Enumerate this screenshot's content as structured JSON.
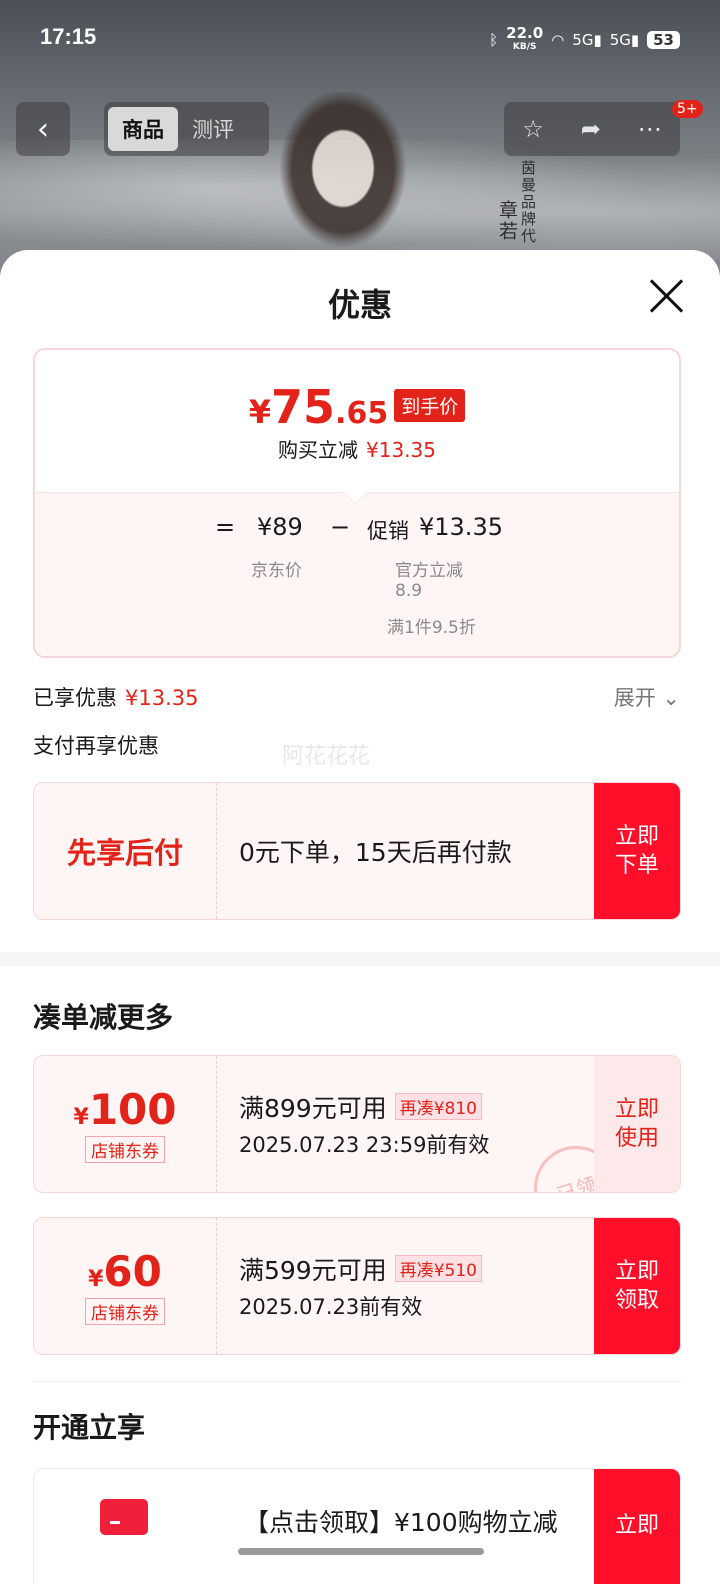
{
  "status": {
    "time": "17:15",
    "speed": "22.0",
    "speed_unit": "KB/S",
    "battery": "53"
  },
  "nav": {
    "tabs": [
      "商品",
      "测评"
    ],
    "badge": "5+"
  },
  "background_text": {
    "brand": "茵曼品牌代",
    "name": "章若"
  },
  "sheet": {
    "title": "优惠",
    "price": {
      "yen": "¥",
      "integer": "75",
      "decimal": ".65",
      "tag": "到手价",
      "reduce_label": "购买立减",
      "reduce_amount": "¥13.35"
    },
    "formula": {
      "eq": "=",
      "jd_price": "¥89",
      "minus": "−",
      "promo_label": "促销",
      "promo_amount": "¥13.35",
      "jd_price_label": "京东价",
      "official_label": "官方立减",
      "official_value": "8.9",
      "condition": "满1件9.5折"
    },
    "enjoyed_label": "已享优惠",
    "enjoyed_amount": "¥13.35",
    "expand_label": "展开",
    "pay_title": "支付再享优惠",
    "watermark": "阿花花花",
    "bnpl": {
      "title": "先享后付",
      "desc": "0元下单，15天后再付款",
      "button": "立即下单"
    },
    "more_title": "凑单减更多",
    "coupons": [
      {
        "yen": "¥",
        "amount": "100",
        "tag": "店铺东券",
        "condition": "满899元可用",
        "chip": "再凑¥810",
        "valid": "2025.07.23 23:59前有效",
        "button": "立即使用",
        "stamp": "已领"
      },
      {
        "yen": "¥",
        "amount": "60",
        "tag": "店铺东券",
        "condition": "满599元可用",
        "chip": "再凑¥510",
        "valid": "2025.07.23前有效",
        "button": "立即领取"
      }
    ],
    "open_title": "开通立享",
    "open_offer": {
      "text": "【点击领取】¥100购物立减",
      "button": "立即"
    }
  },
  "colors": {
    "accent": "#e2231a",
    "button": "#ff0f2a",
    "bg_pink": "#fff5f5"
  }
}
